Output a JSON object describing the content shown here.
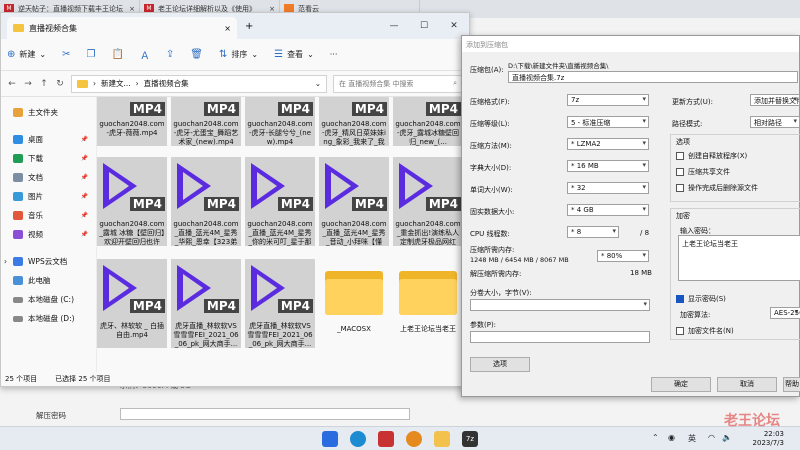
{
  "browser_tabs": [
    {
      "icon": "site-favicon",
      "label": "逆天帖子：直播视频下载丰王论坛"
    },
    {
      "icon": "site-favicon",
      "label": "老王论坛详细解析以及《使用》"
    },
    {
      "icon": "site-favicon-orange",
      "label": "范看云"
    }
  ],
  "explorer": {
    "tab_title": "直播视频合集",
    "toolbar": {
      "new_label": "新建",
      "sort_label": "排序",
      "view_label": "查看",
      "more_label": "···"
    },
    "address": {
      "path_1": "新建文...",
      "path_2": "直播视频合集",
      "search_placeholder": "在 直播视频合集 中搜索"
    },
    "nav_items": [
      {
        "label": "主文件夹",
        "pinned": false
      },
      {
        "label": "桌面",
        "pinned": true
      },
      {
        "label": "下载",
        "pinned": true
      },
      {
        "label": "文档",
        "pinned": true
      },
      {
        "label": "图片",
        "pinned": true
      },
      {
        "label": "音乐",
        "pinned": true
      },
      {
        "label": "视频",
        "pinned": true
      },
      {
        "label": "WPS云文档",
        "pinned": false
      },
      {
        "label": "此电脑",
        "pinned": false
      },
      {
        "label": "本地磁盘 (C:)",
        "pinned": false
      },
      {
        "label": "本地磁盘 (D:)",
        "pinned": false
      }
    ],
    "files": [
      {
        "name": "guochan2048.com-虎牙-薇薇.mp4",
        "kind": "mp4",
        "row": 0
      },
      {
        "name": "guochan2048.com-虎牙-尤蛋宝_舞蹈艺术家_(new).mp4",
        "kind": "mp4",
        "row": 0
      },
      {
        "name": "guochan2048.com-虎牙-长腿兮兮_(new).mp4",
        "kind": "mp4",
        "row": 0
      },
      {
        "name": "guochan2048.com-虎牙_精风日菜妹妹ing_象彩_我来了_我来了_...",
        "kind": "mp4",
        "row": 0
      },
      {
        "name": "guochan2048.com-虎牙_露城冰糖壁回归_new_(...",
        "kind": "mp4",
        "row": 0
      },
      {
        "name": "guochan2048.com_露城 冰糖【壁回归】欢迎开壁回归也许这...",
        "kind": "mp4",
        "row": 1
      },
      {
        "name": "guochan2048.com_直播_蓝光4M_星秀_华熙_恩幸【323弟粉...",
        "kind": "mp4",
        "row": 1
      },
      {
        "name": "guochan2048.com_直播_蓝光4M_星秀_你的米可叮_星于那看...",
        "kind": "mp4",
        "row": 1
      },
      {
        "name": "guochan2048.com_直播_蓝光4M_星秀_音动_小拜咪【懂猫...",
        "kind": "mp4",
        "row": 1
      },
      {
        "name": "guochan2048.com_重金抓出!演练私人定制虎牙极品网红美...",
        "kind": "mp4",
        "row": 1
      },
      {
        "name": "虎牙、林软软 _ 白插 自由.mp4",
        "kind": "mp4",
        "row": 2
      },
      {
        "name": "虎牙直播_林软软VS雪雪雪FEI_2021_06_06_pk_网大商手...",
        "kind": "mp4",
        "row": 2
      },
      {
        "name": "虎牙直播_林软软VS雪雪雪FEI_2021_06_06_pk_网大商手...",
        "kind": "mp4",
        "row": 2
      },
      {
        "name": "_MACOSX",
        "kind": "folder",
        "row": 2
      },
      {
        "name": "上老王论坛当老王",
        "kind": "folder",
        "row": 2
      }
    ],
    "status": {
      "count": "25 个项目",
      "selected": "已选择 25 个项目"
    }
  },
  "background_page": {
    "text_1": "示例：3000M 或 3G",
    "label_password": "解压密码"
  },
  "dialog": {
    "title": "添加到压缩包",
    "archive_label": "压缩包(A):",
    "archive_path": "D:\\下载\\新建文件夹\\直播视频合集\\",
    "archive_name": "直播视频合集.7z",
    "format_label": "压缩格式(F):",
    "format_value": "7z",
    "level_label": "压缩等级(L):",
    "level_value": "5 - 标准压缩",
    "method_label": "压缩方法(M):",
    "method_value": "* LZMA2",
    "dict_label": "字典大小(D):",
    "dict_value": "* 16 MB",
    "word_label": "单词大小(W):",
    "word_value": "* 32",
    "solid_label": "固实数据大小:",
    "solid_value": "* 4 GB",
    "threads_label": "CPU 线程数:",
    "threads_value": "* 8",
    "threads_total": "/ 8",
    "mem_label": "压缩所需内存:",
    "mem_value": "1248 MB / 6454 MB / 8067 MB",
    "mem_percent": "* 80%",
    "unmem_label": "解压缩所需内存:",
    "unmem_value": "18 MB",
    "split_label": "分卷大小，字节(V):",
    "params_label": "参数(P):",
    "options_button": "选项",
    "update_label": "更新方式(U):",
    "update_value": "添加并替换文件",
    "pathmode_label": "路径模式:",
    "pathmode_value": "相对路径",
    "options_group": "选项",
    "opt_sfx": "创建自释放程序(X)",
    "opt_shared": "压缩共享文件",
    "opt_delete": "操作完成后删除源文件",
    "encrypt_group": "加密",
    "password_label": "输入密码：",
    "password_value": "上老王论坛当老王",
    "show_password": "显示密码(S)",
    "enc_method_label": "加密算法:",
    "enc_method_value": "AES-256",
    "encrypt_names": "加密文件名(N)",
    "ok_button": "确定",
    "cancel_button": "取消",
    "help_button": "帮助"
  },
  "taskbar": {
    "ime": "英",
    "time": "22:03",
    "date": "2023/7/3"
  },
  "watermark": "老王论坛"
}
